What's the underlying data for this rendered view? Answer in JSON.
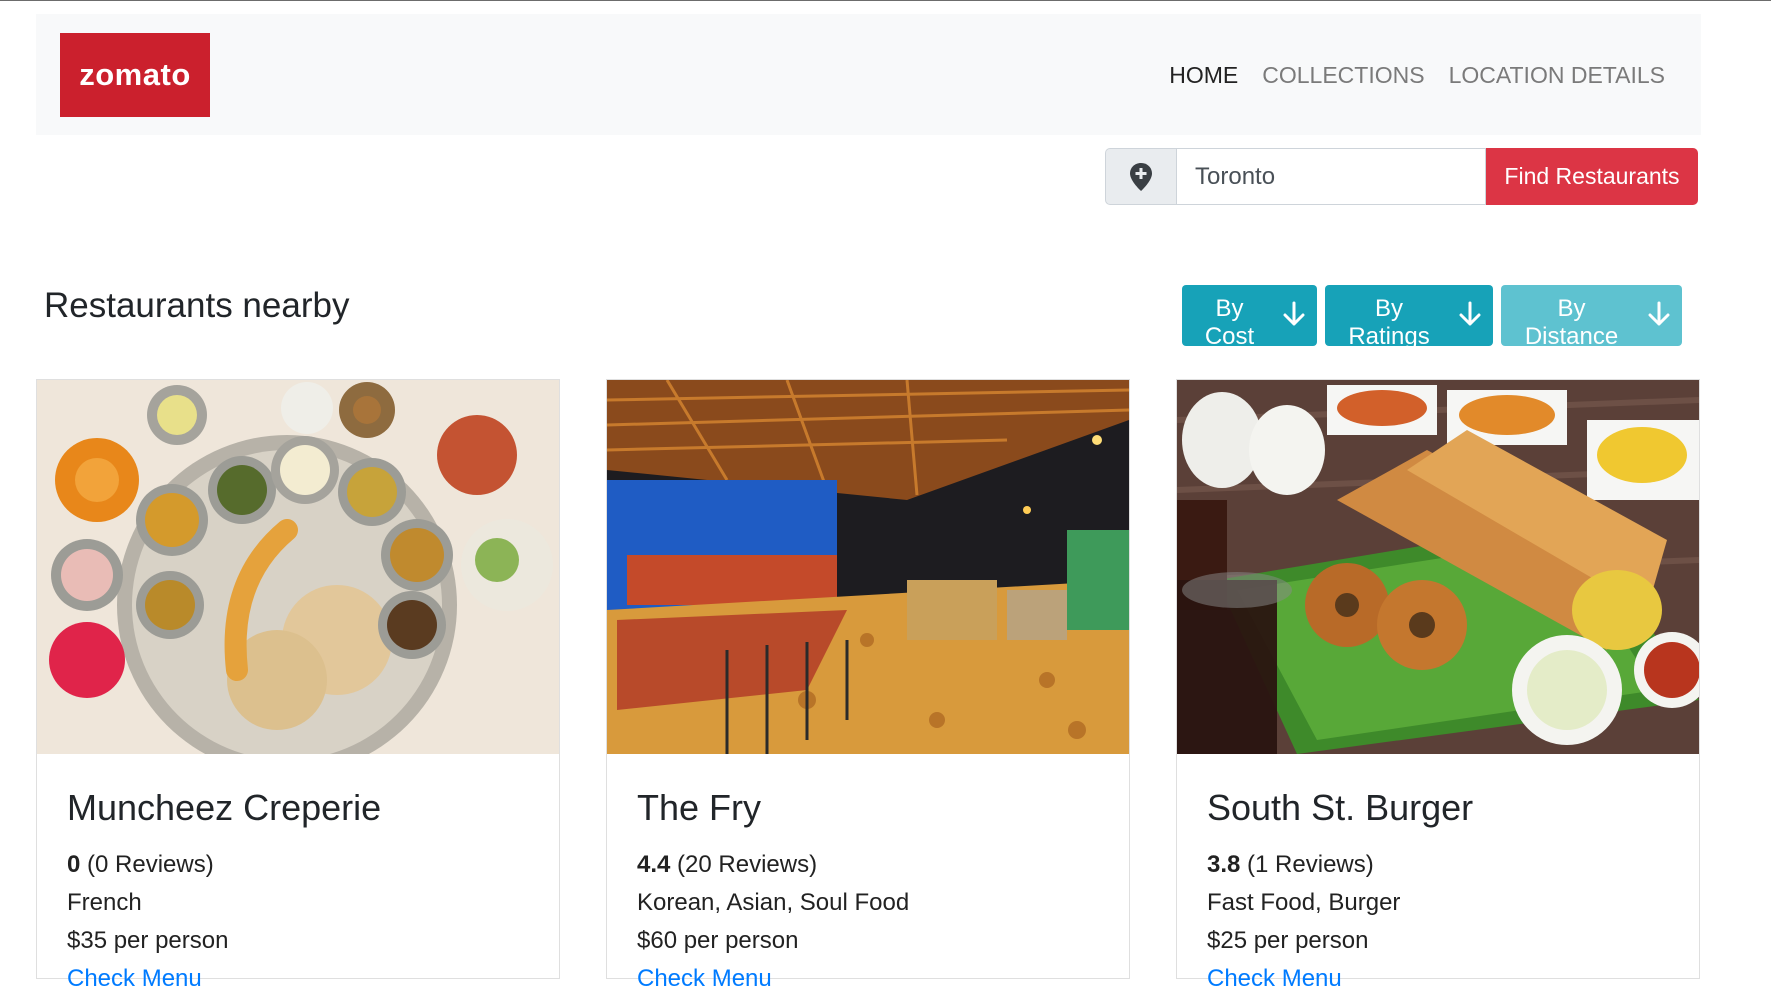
{
  "brand": {
    "logo_text": "zomato",
    "color": "#cb202d"
  },
  "nav": {
    "items": [
      {
        "label": "HOME",
        "active": true
      },
      {
        "label": "COLLECTIONS",
        "active": false
      },
      {
        "label": "LOCATION DETAILS",
        "active": false
      }
    ]
  },
  "search": {
    "icon": "map-pin-icon",
    "location_value": "Toronto",
    "button_label": "Find Restaurants",
    "button_color": "#dc3545"
  },
  "section": {
    "title": "Restaurants nearby"
  },
  "sort": {
    "icon": "arrow-down-icon",
    "buttons": [
      {
        "label": "By Cost"
      },
      {
        "label": "By Ratings"
      },
      {
        "label": "By Distance"
      }
    ],
    "color": "#17a2b8"
  },
  "restaurants": [
    {
      "name": "Muncheez Creperie",
      "rating": "0",
      "reviews": "(0 Reviews)",
      "cuisines": "French",
      "cost": "$35 per person",
      "link": "Check Menu",
      "image": "indian-thali-photo"
    },
    {
      "name": "The Fry",
      "rating": "4.4",
      "reviews": "(20 Reviews)",
      "cuisines": "Korean, Asian, Soul Food",
      "cost": "$60 per person",
      "link": "Check Menu",
      "image": "restaurant-interior-photo"
    },
    {
      "name": "South St. Burger",
      "rating": "3.8",
      "reviews": "(1 Reviews)",
      "cuisines": "Fast Food, Burger",
      "cost": "$25 per person",
      "link": "Check Menu",
      "image": "dosa-platter-photo"
    }
  ]
}
